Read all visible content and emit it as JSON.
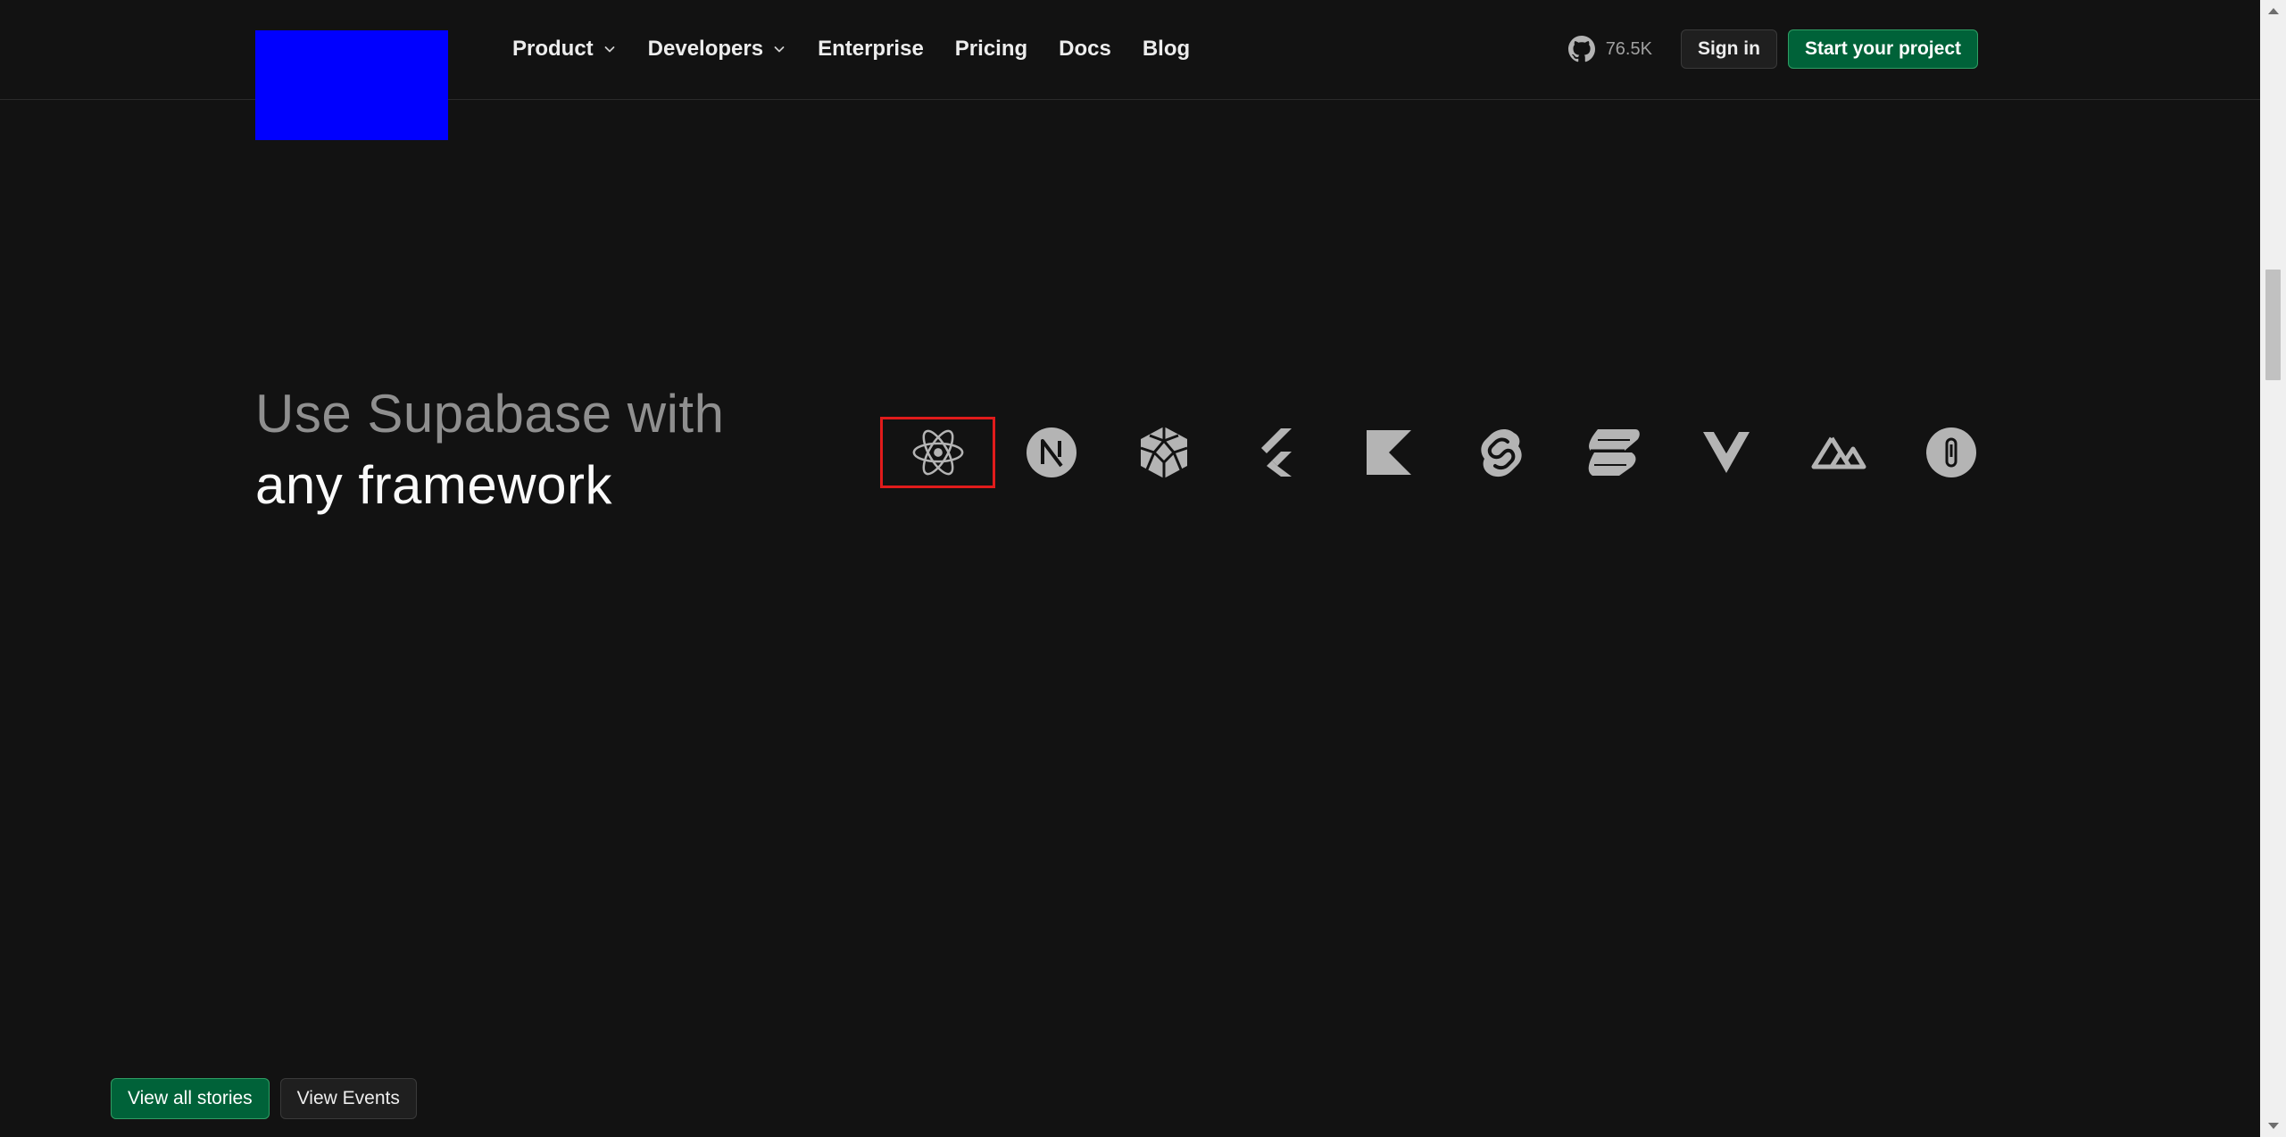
{
  "nav": {
    "items": [
      {
        "label": "Product",
        "has_dropdown": true
      },
      {
        "label": "Developers",
        "has_dropdown": true
      },
      {
        "label": "Enterprise",
        "has_dropdown": false
      },
      {
        "label": "Pricing",
        "has_dropdown": false
      },
      {
        "label": "Docs",
        "has_dropdown": false
      },
      {
        "label": "Blog",
        "has_dropdown": false
      }
    ],
    "github_stars": "76.5K",
    "sign_in_label": "Sign in",
    "start_project_label": "Start your project"
  },
  "hero": {
    "title_line1": "Use Supabase with",
    "title_line2": "any framework"
  },
  "frameworks": [
    {
      "icon": "react-icon",
      "selected": true
    },
    {
      "icon": "nextjs-icon",
      "selected": false
    },
    {
      "icon": "redwoodjs-icon",
      "selected": false
    },
    {
      "icon": "flutter-icon",
      "selected": false
    },
    {
      "icon": "kotlin-icon",
      "selected": false
    },
    {
      "icon": "svelte-icon",
      "selected": false
    },
    {
      "icon": "solidjs-icon",
      "selected": false
    },
    {
      "icon": "vue-icon",
      "selected": false
    },
    {
      "icon": "nuxt-icon",
      "selected": false
    },
    {
      "icon": "expo-icon",
      "selected": false
    }
  ],
  "bottom": {
    "view_all_stories_label": "View all stories",
    "view_events_label": "View Events"
  },
  "colors": {
    "background": "#121212",
    "brand_green": "#006239",
    "brand_green_border": "#2f9e64",
    "icon_gray": "#b4b4b4",
    "selection_red": "#e01b1b",
    "logo_placeholder": "#0000ff"
  }
}
